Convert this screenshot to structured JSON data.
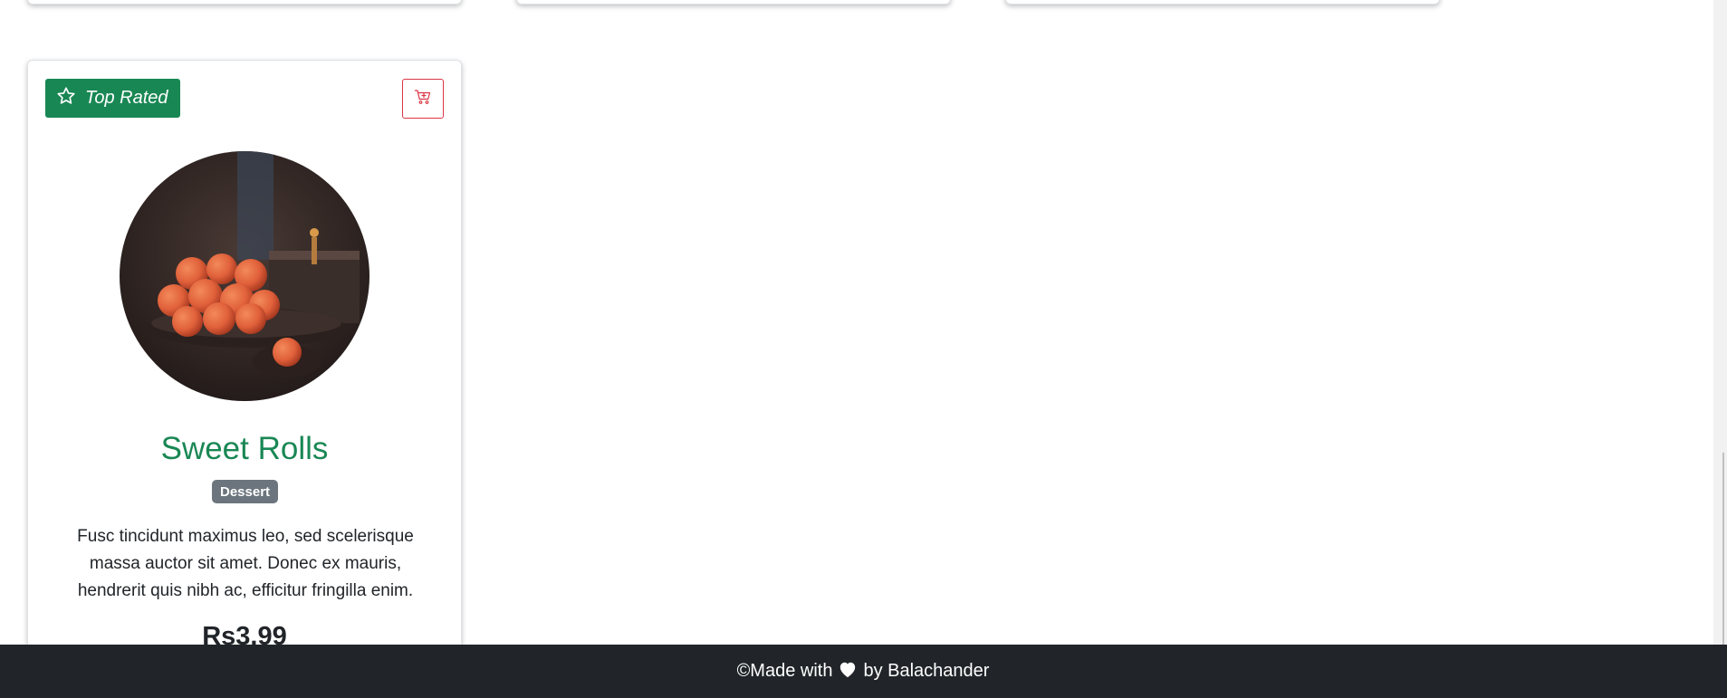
{
  "cards": [
    {
      "badge": {
        "label": "Top Rated",
        "icon": "star-icon",
        "color": "#198754"
      },
      "cart_icon": "cart-plus-icon",
      "image": "sweet-rolls-photo",
      "title": "Sweet Rolls",
      "category": "Dessert",
      "description": "Fusc tincidunt maximus leo, sed scelerisque massa auctor sit amet. Donec ex mauris, hendrerit quis nibh ac, efficitur fringilla enim.",
      "price": "Rs3.99"
    }
  ],
  "footer": {
    "prefix": "©Made with",
    "heart_icon": "heart-icon",
    "suffix": "by Balachander"
  },
  "colors": {
    "accent": "#198754",
    "danger": "#dc3545",
    "badge_gray": "#6c757d",
    "footer_bg": "#212529"
  }
}
